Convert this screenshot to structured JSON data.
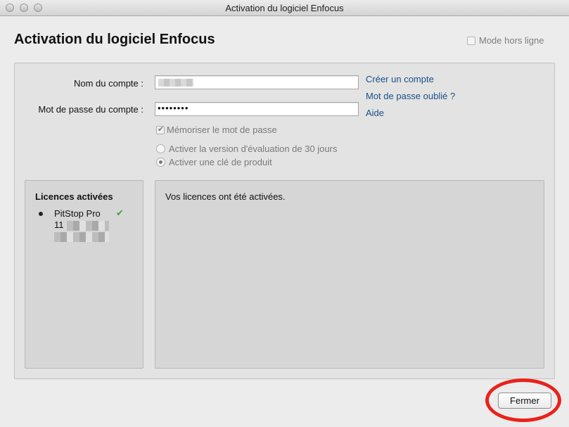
{
  "window": {
    "title": "Activation du logiciel Enfocus"
  },
  "header": {
    "title": "Activation du logiciel Enfocus",
    "offline_label": "Mode hors ligne"
  },
  "form": {
    "account_label": "Nom du compte :",
    "password_label": "Mot de passe du compte :",
    "password_value": "••••••••",
    "remember_label": "Mémoriser le mot de passe",
    "options": [
      {
        "label": "Activer la version d'évaluation de 30 jours",
        "selected": false
      },
      {
        "label": "Activer une clé de produit",
        "selected": true
      }
    ]
  },
  "links": {
    "create_account": "Créer un compte",
    "forgot_password": "Mot de passe oublié ?",
    "help": "Aide"
  },
  "licenses": {
    "heading": "Licences activées",
    "items": [
      {
        "name": "PitStop Pro",
        "number_prefix": "11",
        "status_icon": "checkmark-icon"
      }
    ]
  },
  "message": {
    "text": "Vos licences ont été activées."
  },
  "footer": {
    "close_label": "Fermer"
  },
  "colors": {
    "link": "#1a4f86",
    "highlight_ring": "#e8231b",
    "check": "#3fa63a"
  }
}
